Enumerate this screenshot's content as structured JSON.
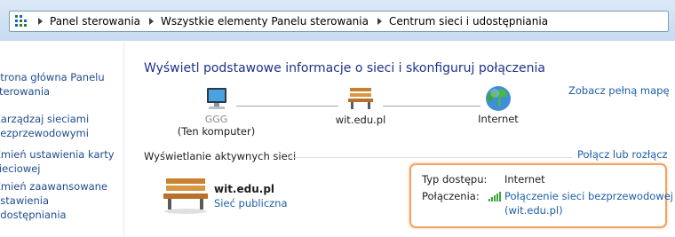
{
  "breadcrumb": {
    "items": [
      "Panel sterowania",
      "Wszystkie elementy Panelu sterowania",
      "Centrum sieci i udostępniania"
    ]
  },
  "sidebar": {
    "items": [
      {
        "label": "Strona główna Panelu\nsterowania"
      },
      {
        "label": "Zarządzaj sieciami\nbezprzewodowymi"
      },
      {
        "label": "Zmień ustawienia karty\nsieciowej"
      },
      {
        "label": "Zmień zaawansowane\nustawienia udostępniania"
      }
    ]
  },
  "main": {
    "title": "Wyświetl podstawowe informacje o sieci i skonfiguruj połączenia",
    "see_full_map": "Zobacz pełną mapę",
    "map": {
      "computer_name": "GGG",
      "computer_sub": "(Ten komputer)",
      "network_name": "wit.edu.pl",
      "internet": "Internet"
    },
    "active_section": "Wyświetlanie aktywnych sieci",
    "connect_link": "Połącz lub rozłącz",
    "network": {
      "name": "wit.edu.pl",
      "type": "Sieć publiczna"
    },
    "details": {
      "access_label": "Typ dostępu:",
      "access_value": "Internet",
      "connections_label": "Połączenia:",
      "connection_line1": "Połączenie sieci bezprzewodowej",
      "connection_line2": "(wit.edu.pl)"
    }
  },
  "colors": {
    "link": "#1e5fa8",
    "title": "#1e3287",
    "highlight_border": "#f2a265"
  }
}
